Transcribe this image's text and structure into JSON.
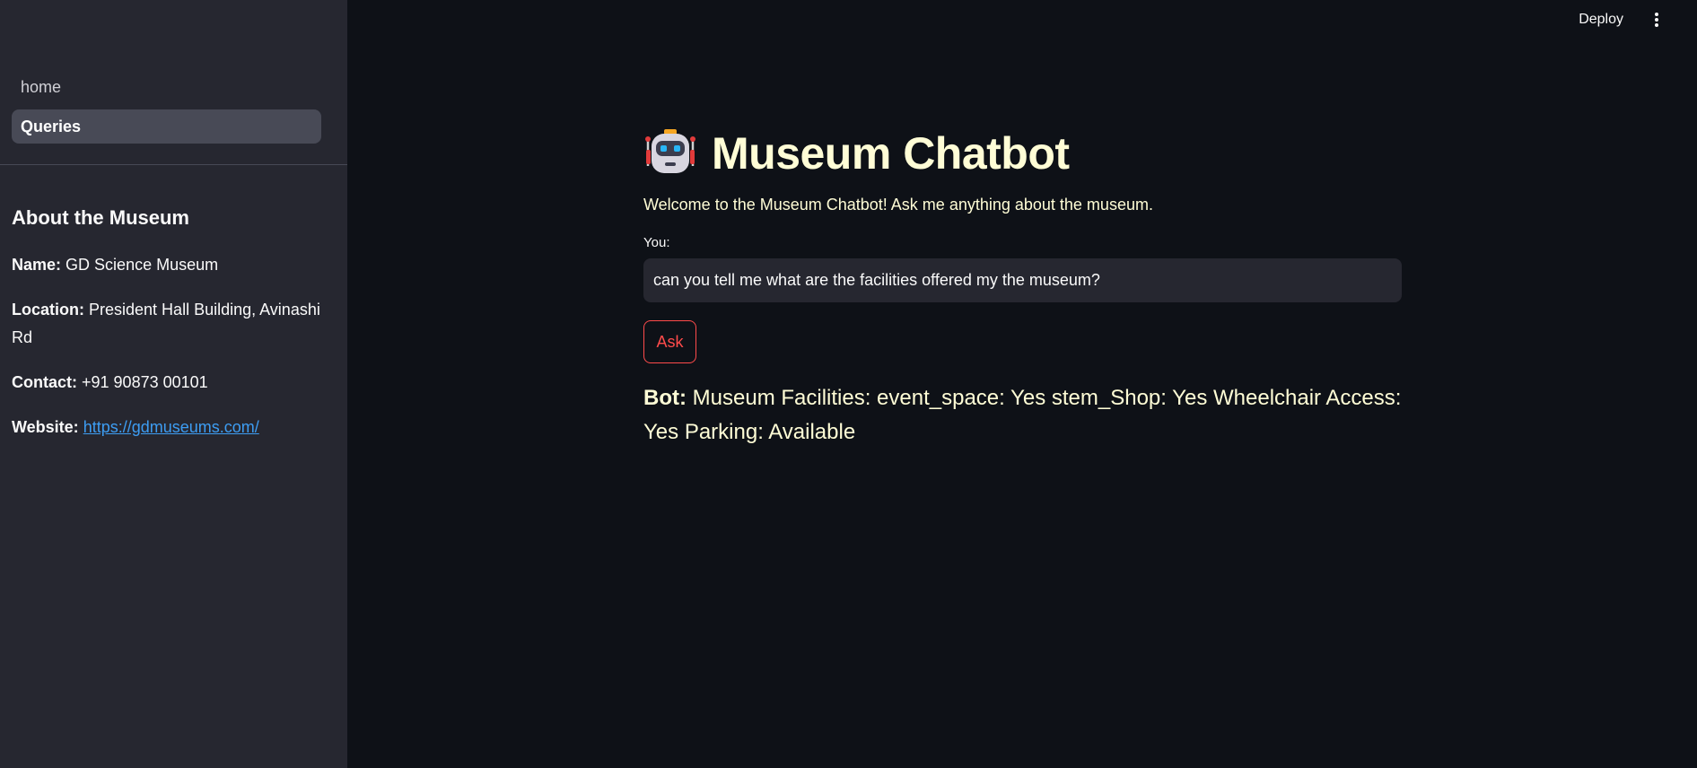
{
  "sidebar": {
    "nav": [
      {
        "label": "home"
      },
      {
        "label": "Queries"
      }
    ],
    "about": {
      "heading": "About the Museum",
      "name_label": "Name:",
      "name_value": "GD Science Museum",
      "location_label": "Location:",
      "location_value": "President Hall Building, Avinashi Rd",
      "contact_label": "Contact:",
      "contact_value": "+91 90873 00101",
      "website_label": "Website:",
      "website_value": "https://gdmuseums.com/"
    }
  },
  "topbar": {
    "deploy_label": "Deploy",
    "menu_icon": "vertical-ellipsis-icon"
  },
  "main": {
    "title_icon": "robot-icon",
    "title": "Museum Chatbot",
    "welcome": "Welcome to the Museum Chatbot! Ask me anything about the museum.",
    "input_label": "You:",
    "input_value": "can you tell me what are the facilities offered my the museum?",
    "ask_label": "Ask",
    "bot_prefix": "Bot:",
    "bot_answer": "Museum Facilities: event_space: Yes stem_Shop: Yes Wheelchair Access: Yes Parking: Available"
  },
  "colors": {
    "background": "#0e1117",
    "sidebar": "#262730",
    "accent": "#ff4b4b",
    "title_text": "#fffdd6",
    "link": "#3d9df3"
  }
}
